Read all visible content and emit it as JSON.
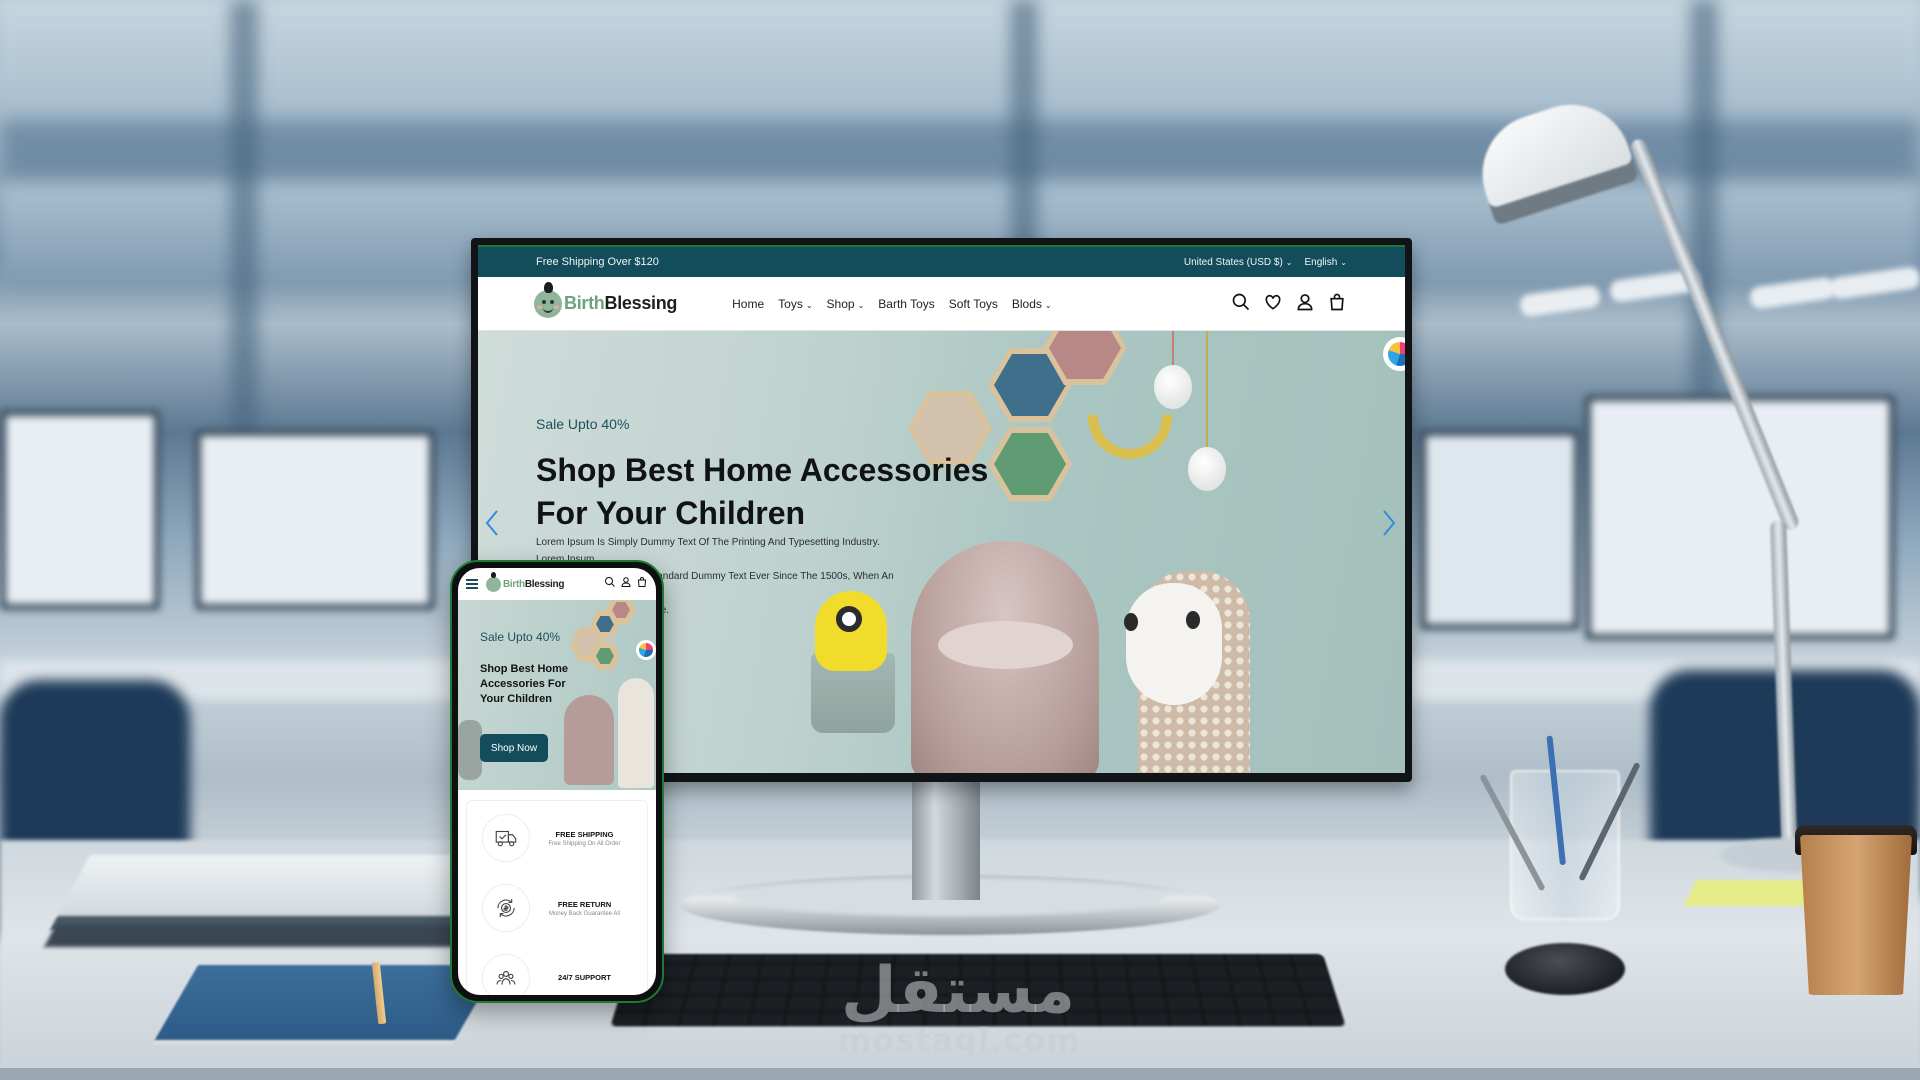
{
  "watermark": {
    "arabic": "مستقل",
    "latin": "mostaql.com"
  },
  "site": {
    "topbar": {
      "promo": "Free Shipping Over $120",
      "currency": "United States (USD $)",
      "language": "English"
    },
    "logo": {
      "part1": "Birth",
      "part2": "Blessing"
    },
    "nav": [
      {
        "label": "Home",
        "has_dropdown": false
      },
      {
        "label": "Toys",
        "has_dropdown": true
      },
      {
        "label": "Shop",
        "has_dropdown": true
      },
      {
        "label": "Barth Toys",
        "has_dropdown": false
      },
      {
        "label": "Soft Toys",
        "has_dropdown": false
      },
      {
        "label": "Blods",
        "has_dropdown": true
      }
    ],
    "nav_icons": [
      "search-icon",
      "heart-icon",
      "user-icon",
      "bag-icon"
    ],
    "hero": {
      "sale": "Sale Upto 40%",
      "title_line1": "Shop Best Home Accessories",
      "title_line2": "For Your Children",
      "desc_line1": "Lorem Ipsum Is Simply Dummy Text Of The Printing And Typesetting Industry. Lorem Ipsum",
      "desc_line2": "Has Been The Industry's Standard Dummy Text Ever Since The 1500s, When An Unknown",
      "desc_line3": "Printer Took A Galley Of Type."
    },
    "colors": {
      "primary": "#134d5b",
      "logo_green": "#6fa37c",
      "slider_arrow": "#2f8ce0"
    }
  },
  "mobile": {
    "hero": {
      "sale": "Sale Upto 40%",
      "title": "Shop Best Home Accessories For Your Children",
      "button": "Shop Now"
    },
    "features": [
      {
        "title": "FREE SHIPPING",
        "subtitle": "Free Shipping On All Order",
        "icon": "truck-icon"
      },
      {
        "title": "FREE RETURN",
        "subtitle": "Money Back Guarantee All",
        "icon": "money-return-icon"
      },
      {
        "title": "24/7 SUPPORT",
        "subtitle": "",
        "icon": "support-team-icon"
      }
    ]
  }
}
